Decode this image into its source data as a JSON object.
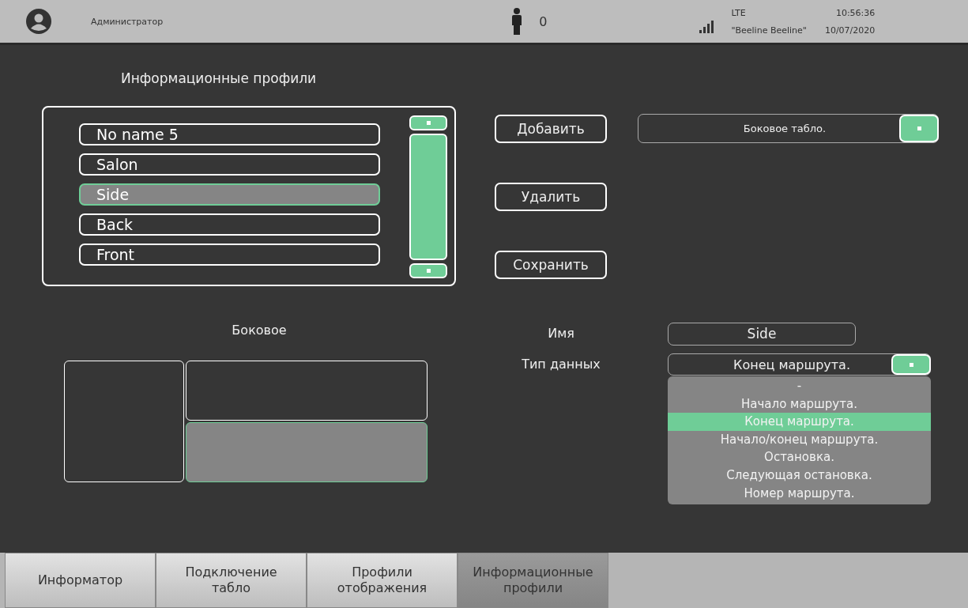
{
  "status_bar": {
    "user": "Администратор",
    "person_count": "0",
    "network": "LTE",
    "operator": "\"Beeline Beeline\"",
    "time": "10:56:36",
    "date": "10/07/2020"
  },
  "profiles_title": "Информационные профили",
  "profiles": [
    {
      "label": "No name 5",
      "selected": false
    },
    {
      "label": "Salon",
      "selected": false
    },
    {
      "label": "Side",
      "selected": true
    },
    {
      "label": "Back",
      "selected": false
    },
    {
      "label": "Front",
      "selected": false
    }
  ],
  "buttons": [
    "Добавить",
    "Удалить",
    "Сохранить"
  ],
  "display_select": {
    "value": "Боковое табло."
  },
  "preview": {
    "title": "Боковое",
    "cells": [
      {
        "kind": "tall",
        "selected": false
      },
      {
        "kind": "wide",
        "selected": false
      },
      {
        "kind": "wide",
        "selected": true
      }
    ]
  },
  "form": {
    "name_label": "Имя",
    "name_value": "Side",
    "type_label": "Тип данных",
    "type_value": "Конец маршрута.",
    "type_options": [
      {
        "label": "-",
        "selected": false
      },
      {
        "label": "Начало маршрута.",
        "selected": false
      },
      {
        "label": "Конец маршрута.",
        "selected": true
      },
      {
        "label": "Начало/конец маршрута.",
        "selected": false
      },
      {
        "label": "Остановка.",
        "selected": false
      },
      {
        "label": "Следующая остановка.",
        "selected": false
      },
      {
        "label": "Номер маршрута.",
        "selected": false
      }
    ]
  },
  "tabs": [
    {
      "label": "Информатор",
      "selected": false
    },
    {
      "label": "Подключение\nтабло",
      "selected": false
    },
    {
      "label": "Профили\nотображения",
      "selected": false
    },
    {
      "label": "Информационные\nпрофили",
      "selected": true
    }
  ]
}
